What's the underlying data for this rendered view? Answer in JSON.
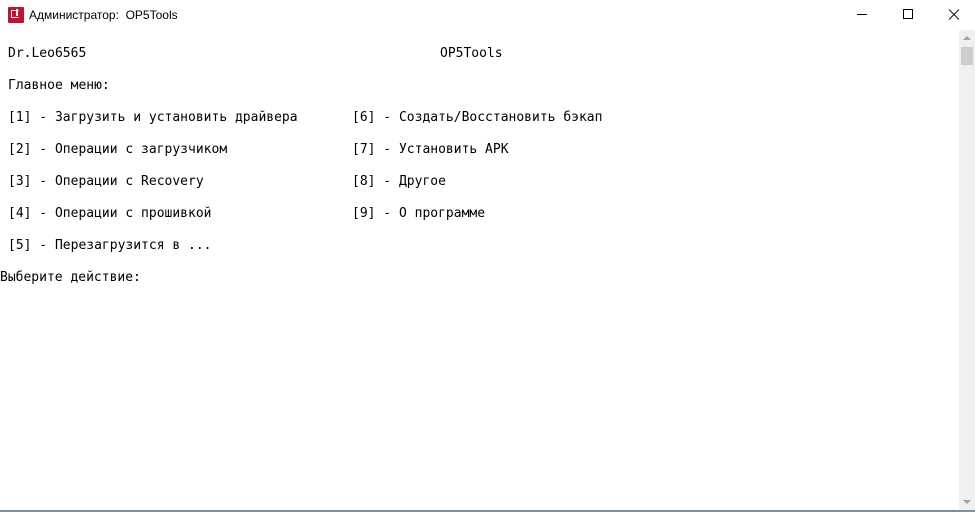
{
  "window": {
    "title": "Администратор:  OP5Tools",
    "controls": {
      "minimize_icon": "minimize-icon",
      "maximize_icon": "maximize-icon",
      "close_icon": "close-icon"
    },
    "icon": "oneplus-app-icon",
    "accent_color": "#c8102e"
  },
  "console": {
    "author": "Dr.Leo6565",
    "app_name": "OP5Tools",
    "menu_header": "Главное меню:",
    "menu_left": [
      "[1] - Загрузить и установить драйвера",
      "[2] - Операции с загрузчиком",
      "[3] - Операции с Recovery",
      "[4] - Операции с прошивкой",
      "[5] - Перезагрузится в ..."
    ],
    "menu_right": [
      "[6] - Создать/Восстановить бэкап",
      "[7] - Установить APK",
      "[8] - Другое",
      "[9] - О программе"
    ],
    "prompt": "Выберите действие:"
  }
}
